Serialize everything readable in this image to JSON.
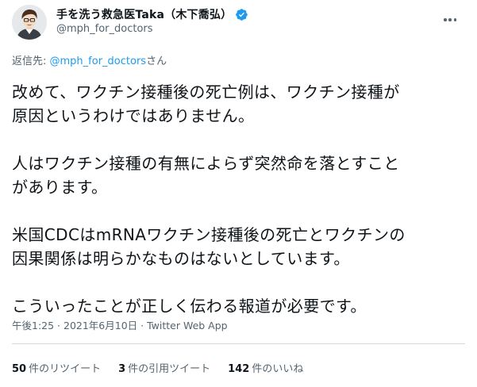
{
  "author": {
    "display_name": "手を洗う救急医Taka（木下喬弘）",
    "handle": "@mph_for_doctors",
    "avatar_icon": "person-avatar-icon",
    "verified_icon": "verified-badge-icon",
    "verified_color": "#1d9bf0"
  },
  "menu": {
    "icon": "more-horizontal-icon"
  },
  "reply": {
    "prefix": "返信先: ",
    "mention": "@mph_for_doctors",
    "suffix": "さん"
  },
  "tweet": {
    "lines": [
      "改めて、ワクチン接種後の死亡例は、ワクチン接種が",
      "原因というわけではありません。",
      "人はワクチン接種の有無によらず突然命を落とすこと",
      "があります。",
      "米国CDCはmRNAワクチン接種後の死亡とワクチンの",
      "因果関係は明らかなものはないとしています。",
      "こういったことが正しく伝わる報道が必要です。"
    ]
  },
  "meta": {
    "time": "午後1:25",
    "separator": " · ",
    "date": "2021年6月10日",
    "source": "Twitter Web App"
  },
  "stats": {
    "retweets_count": "50",
    "retweets_label": "件のリツイート",
    "quotes_count": "3",
    "quotes_label": "件の引用ツイート",
    "likes_count": "142",
    "likes_label": "件のいいね"
  },
  "colors": {
    "text_primary": "#0f1419",
    "text_secondary": "#536471",
    "link": "#1d9bf0",
    "divider": "#cfd9de"
  }
}
